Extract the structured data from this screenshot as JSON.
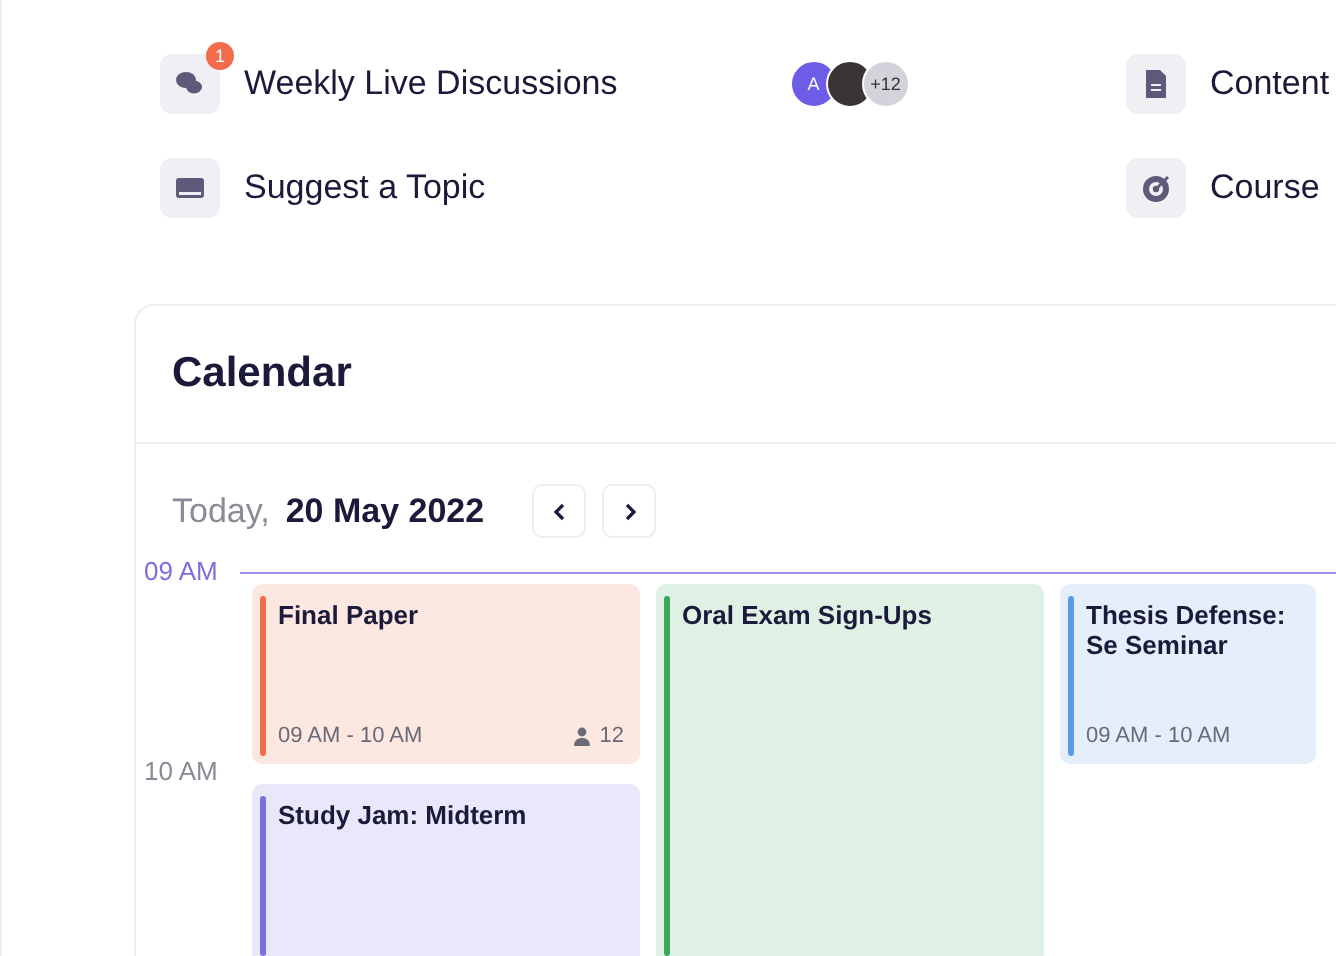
{
  "links": [
    {
      "kind": "chat",
      "label": "Weekly Live Discussions",
      "badge": "1",
      "avatars": {
        "initial": "A",
        "more": "+12"
      }
    },
    {
      "kind": "document",
      "label": "Content"
    },
    {
      "kind": "tray",
      "label": "Suggest a Topic"
    },
    {
      "kind": "target",
      "label": "Course"
    }
  ],
  "calendar": {
    "title": "Calendar",
    "today_label": "Today,",
    "date": "20 May 2022",
    "times": [
      "09 AM",
      "10 AM"
    ],
    "events": [
      {
        "title": "Final Paper",
        "time": "09 AM - 10 AM",
        "attendees": "12",
        "color": "#f26b4a"
      },
      {
        "title": "Study Jam: Midterm",
        "color": "#7b6fe0"
      },
      {
        "title": "Oral Exam Sign-Ups",
        "color": "#3aa85c"
      },
      {
        "title": "Thesis Defense: Se Seminar",
        "time": "09 AM - 10 AM",
        "color": "#5b9be6"
      }
    ]
  }
}
